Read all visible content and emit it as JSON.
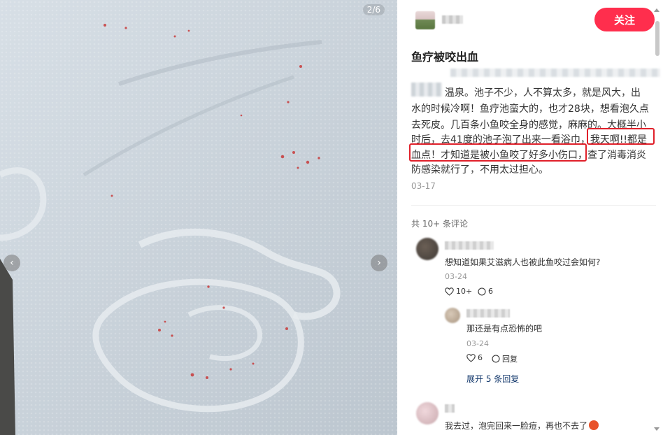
{
  "media": {
    "counter": "2/6",
    "prev_icon": "chevron-left-icon",
    "next_icon": "chevron-right-icon",
    "prev_glyph": "‹",
    "next_glyph": "›"
  },
  "author": {
    "follow_label": "关注"
  },
  "post": {
    "title": "鱼疗被咬出血",
    "lines": [
      "温泉。池子不少，人不算太多，就是风大，出",
      "水的时候冷啊！鱼疗池蛮大的，也才28块，想看泡久点",
      "去死皮。几百条小鱼咬全身的感觉，麻麻的。大概半小",
      "时后，去41度的池子泡了出来一看浴巾，我天啊!!都是",
      "血点！才知道是被小鱼咬了好多小伤口，查了消毒消炎",
      "防感染就行了，不用太过担心。"
    ],
    "date": "03-17"
  },
  "comments": {
    "count_label": "共 10+ 条评论",
    "items": [
      {
        "text": "想知道如果艾滋病人也被此鱼咬过会如何?",
        "date": "03-24",
        "likes": "10+",
        "replies_count": "6"
      }
    ],
    "reply": {
      "text": "那还是有点恐怖的吧",
      "date": "03-24",
      "likes": "6",
      "reply_label": "回复"
    },
    "expand_label": "展开 5 条回复",
    "last": {
      "text": "我去过，泡完回来一脸痘，再也不去了"
    }
  },
  "colors": {
    "accent": "#ff2e4d",
    "highlight_box": "#e0202a",
    "link": "#13386c"
  }
}
